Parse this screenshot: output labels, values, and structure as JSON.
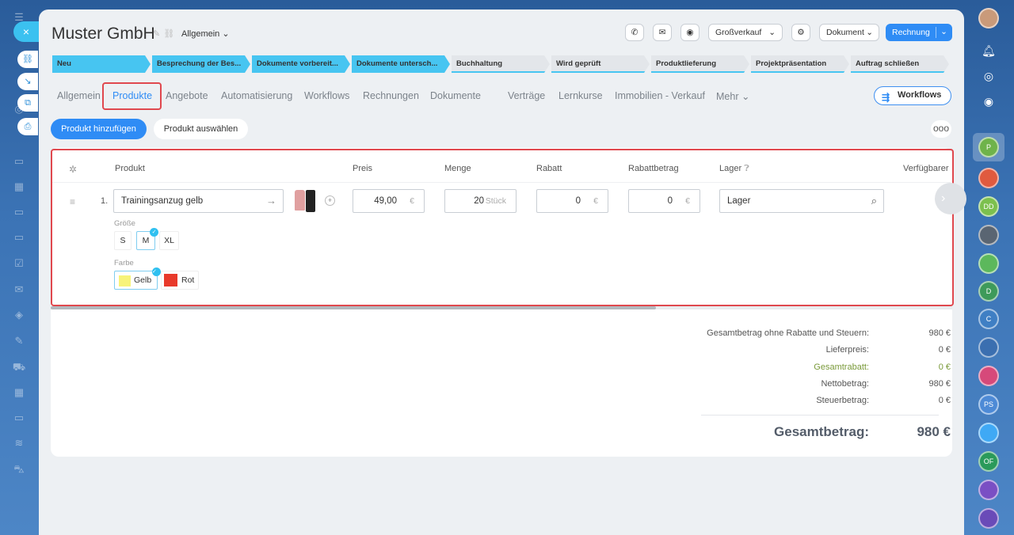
{
  "leftbar": {
    "close_icon": "×",
    "tab_icons": [
      "link-icon",
      "arrow-in-icon",
      "open-icon",
      "print-icon"
    ]
  },
  "header": {
    "title": "Muster GmbH",
    "category": "Allgemein",
    "pipeline_select": "Großverkauf",
    "document_btn": "Dokument",
    "invoice_btn": "Rechnung"
  },
  "stages": [
    {
      "label": "Neu",
      "done": true
    },
    {
      "label": "Besprechung der Bes...",
      "done": true
    },
    {
      "label": "Dokumente vorbereit...",
      "done": true
    },
    {
      "label": "Dokumente untersch...",
      "done": true
    },
    {
      "label": "Buchhaltung",
      "done": false
    },
    {
      "label": "Wird geprüft",
      "done": false
    },
    {
      "label": "Produktlieferung",
      "done": false
    },
    {
      "label": "Projektpräsentation",
      "done": false
    },
    {
      "label": "Auftrag schließen",
      "done": false
    }
  ],
  "tabs": [
    {
      "label": "Allgemein"
    },
    {
      "label": "Produkte",
      "active": true
    },
    {
      "label": "Angebote"
    },
    {
      "label": "Automatisierung"
    },
    {
      "label": "Workflows"
    },
    {
      "label": "Rechnungen"
    },
    {
      "label": "Dokumente"
    },
    {
      "label": "Verträge"
    },
    {
      "label": "Lernkurse"
    },
    {
      "label": "Immobilien - Verkauf"
    },
    {
      "label": "Mehr"
    }
  ],
  "workflows_btn": "Workflows",
  "actions": {
    "add": "Produkt hinzufügen",
    "select": "Produkt auswählen",
    "more": "ooo"
  },
  "table": {
    "headers": {
      "product": "Produkt",
      "price": "Preis",
      "qty": "Menge",
      "discount": "Rabatt",
      "discount_amount": "Rabattbetrag",
      "stock": "Lager",
      "available": "Verfügbarer"
    },
    "row": {
      "index": "1.",
      "name": "Trainingsanzug gelb",
      "price": "49,00",
      "currency": "€",
      "qty": "20",
      "unit": "Stück",
      "discount": "0",
      "discount_amount": "0",
      "stock_placeholder": "Lager",
      "size_label": "Größe",
      "sizes": [
        "S",
        "M",
        "XL"
      ],
      "selected_size": "M",
      "color_label": "Farbe",
      "colors": [
        {
          "name": "Gelb",
          "hex": "#f7f37a",
          "selected": true
        },
        {
          "name": "Rot",
          "hex": "#e8392a",
          "selected": false
        }
      ]
    }
  },
  "totals": {
    "rows": [
      {
        "label": "Gesamtbetrag ohne Rabatte und Steuern:",
        "value": "980 €"
      },
      {
        "label": "Lieferpreis:",
        "value": "0 €"
      },
      {
        "label": "Gesamtrabatt:",
        "value": "0 €",
        "green": true
      },
      {
        "label": "Nettobetrag:",
        "value": "980 €"
      },
      {
        "label": "Steuerbetrag:",
        "value": "0 €"
      }
    ],
    "grand_label": "Gesamtbetrag:",
    "grand_value": "980 €"
  },
  "rightbar": {
    "avatars": [
      "P",
      "DD",
      "D",
      "C",
      "PS",
      "OF"
    ]
  },
  "colors": {
    "accent": "#2f8cf5",
    "stage_done": "#47c5f1",
    "highlight": "#e0484e"
  }
}
